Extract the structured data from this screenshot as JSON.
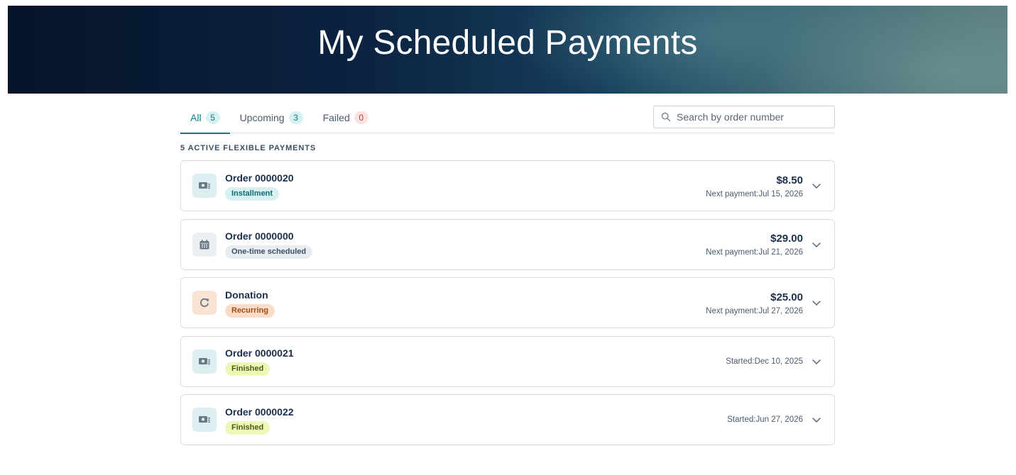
{
  "header": {
    "title": "My Scheduled Payments"
  },
  "tabs": [
    {
      "label": "All",
      "count": "5",
      "active": true,
      "tone": "teal"
    },
    {
      "label": "Upcoming",
      "count": "3",
      "active": false,
      "tone": "teal"
    },
    {
      "label": "Failed",
      "count": "0",
      "active": false,
      "tone": "red"
    }
  ],
  "search": {
    "placeholder": "Search by order number",
    "value": ""
  },
  "section_label": "5 ACTIVE FLEXIBLE PAYMENTS",
  "payments": [
    {
      "title": "Order 0000020",
      "badge": "Installment",
      "amount": "$8.50",
      "meta_label": "Next payment:",
      "meta_date": "Jul 15, 2026",
      "icon": "cash-icon"
    },
    {
      "title": "Order 0000000",
      "badge": "One-time scheduled",
      "amount": "$29.00",
      "meta_label": "Next payment:",
      "meta_date": "Jul 21, 2026",
      "icon": "calendar-icon"
    },
    {
      "title": "Donation",
      "badge": "Recurring",
      "amount": "$25.00",
      "meta_label": "Next payment:",
      "meta_date": "Jul 27, 2026",
      "icon": "recurring-arrow-icon"
    },
    {
      "title": "Order 0000021",
      "badge": "Finished",
      "amount": "",
      "meta_label": "Started:",
      "meta_date": "Dec 10, 2025",
      "icon": "cash-icon"
    },
    {
      "title": "Order 0000022",
      "badge": "Finished",
      "amount": "",
      "meta_label": "Started:",
      "meta_date": "Jun 27, 2026",
      "icon": "cash-icon"
    }
  ],
  "colors": {
    "accent": "#0e7c86",
    "installment_badge": "#d7f0f1",
    "scheduled_badge": "#e8edf2",
    "recurring_badge": "#fbdcc8",
    "finished_badge": "#eef6b8"
  }
}
